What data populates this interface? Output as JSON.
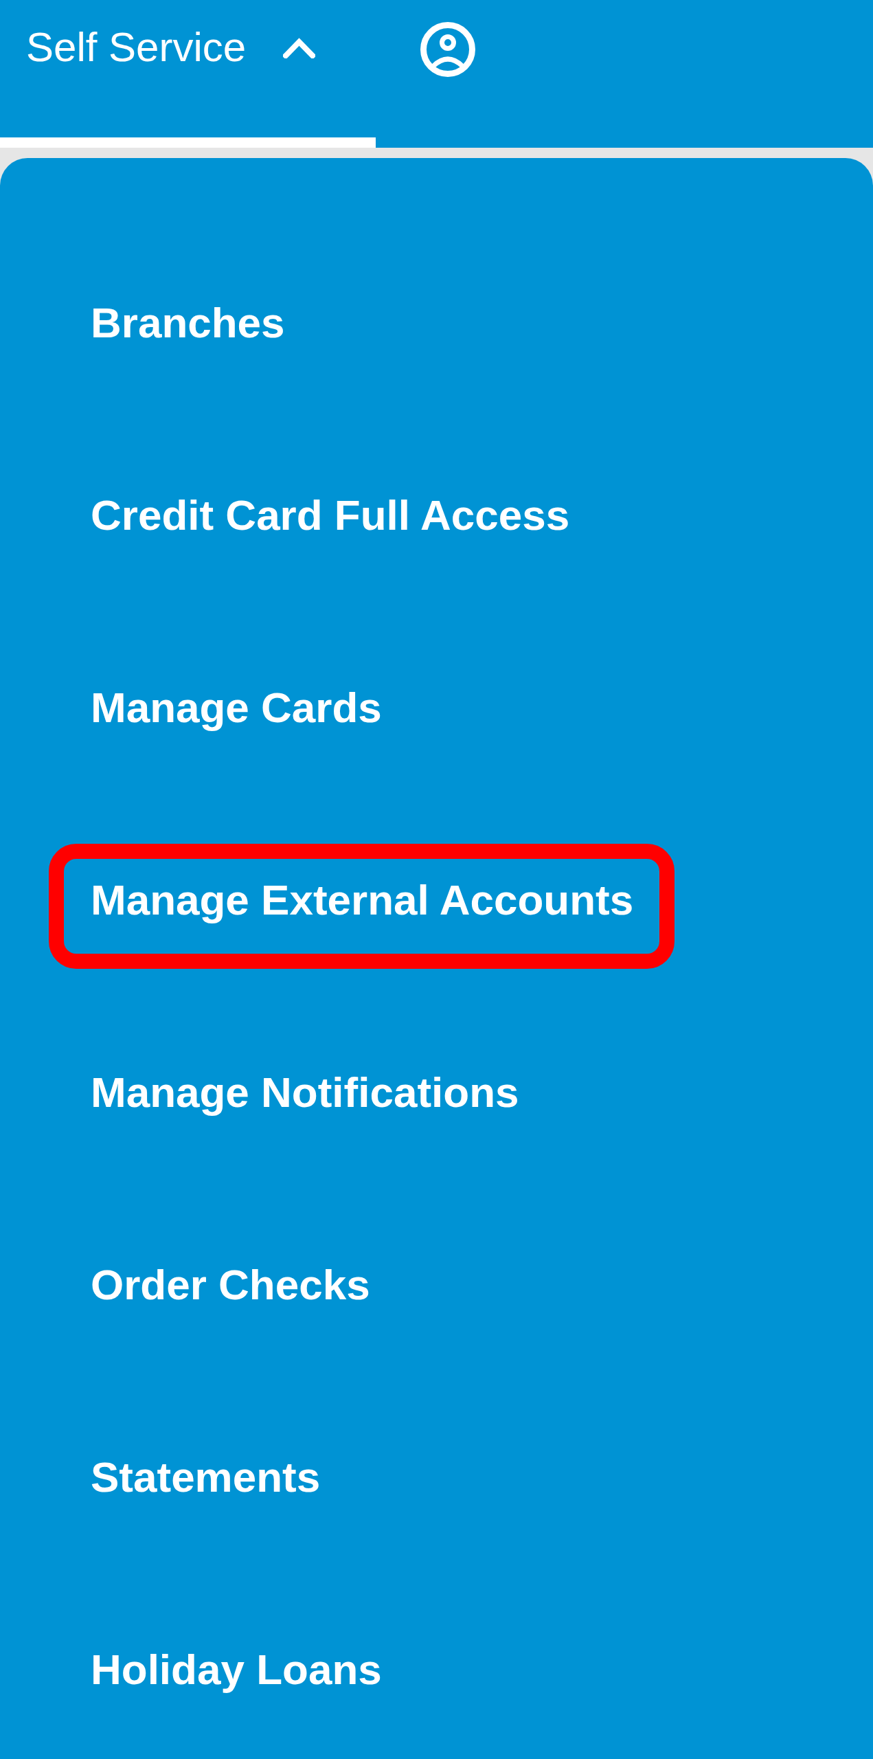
{
  "header": {
    "tabs": [
      {
        "label": "Self Service",
        "selected": true,
        "expanded": true
      }
    ]
  },
  "menu": {
    "items": [
      {
        "label": "Branches",
        "highlighted": false
      },
      {
        "label": "Credit Card Full Access",
        "highlighted": false
      },
      {
        "label": "Manage Cards",
        "highlighted": false
      },
      {
        "label": "Manage External Accounts",
        "highlighted": true
      },
      {
        "label": "Manage Notifications",
        "highlighted": false
      },
      {
        "label": "Order Checks",
        "highlighted": false
      },
      {
        "label": "Statements",
        "highlighted": false
      },
      {
        "label": "Holiday Loans",
        "highlighted": false
      }
    ]
  }
}
